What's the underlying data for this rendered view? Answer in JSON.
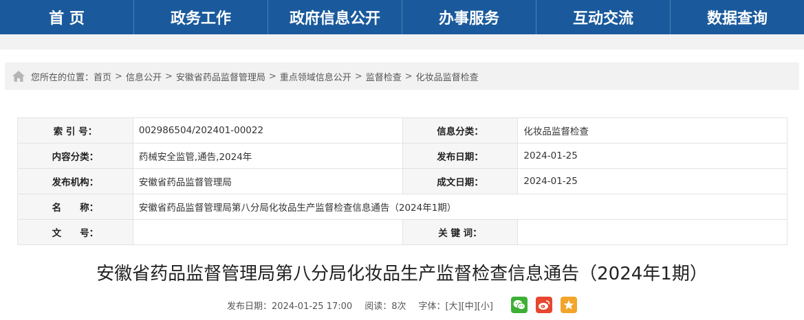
{
  "nav": [
    "首 页",
    "政务工作",
    "政府信息公开",
    "办事服务",
    "互动交流",
    "数据查询"
  ],
  "breadcrumb": {
    "prefix": "您所在的位置：",
    "items": [
      "首页",
      "信息公开",
      "安徽省药品监督管理局",
      "重点领域信息公开",
      "监督检查",
      "化妆品监督检查"
    ],
    "separator": ">"
  },
  "meta": {
    "index_label": "索 引 号：",
    "index_value": "002986504/202401-00022",
    "category_label": "信息分类：",
    "category_value": "化妆品监督检查",
    "content_label": "内容分类：",
    "content_value": "药械安全监管,通告,2024年",
    "pubdate_label": "发布日期：",
    "pubdate_value": "2024-01-25",
    "org_label": "发布机构：",
    "org_value": "安徽省药品监督管理局",
    "written_label": "成文日期：",
    "written_value": "2024-01-25",
    "name_label": "名　　称：",
    "name_value": "安徽省药品监督管理局第八分局化妆品生产监督检查信息通告（2024年1期）",
    "docno_label": "文　　号：",
    "docno_value": "",
    "keywords_label": "关 键 词：",
    "keywords_value": ""
  },
  "article": {
    "title": "安徽省药品监督管理局第八分局化妆品生产监督检查信息通告（2024年1期）",
    "pub_text": "发布日期：2024-01-25 17:00",
    "reads_text": "阅读：8次",
    "font_label": "字体：",
    "font_large": "[大]",
    "font_medium": "[中]",
    "font_small": "[小]"
  },
  "colors": {
    "nav_bg": "#1a5a9c",
    "wechat": "#3cb034",
    "weibo": "#e6472e",
    "star": "#f2a52a"
  },
  "icons": [
    "home-icon",
    "wechat-icon",
    "weibo-icon",
    "star-icon"
  ]
}
